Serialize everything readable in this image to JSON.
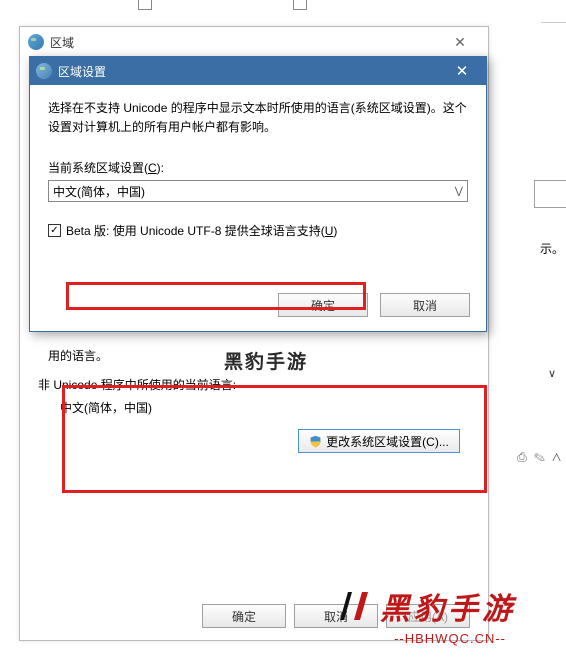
{
  "bg": {
    "right_text": "示。",
    "right_v": "∨",
    "right_icons": "⎙ ✎ ⋀"
  },
  "outer": {
    "title": "区域",
    "body_trail": "用的语言。",
    "section_label": "非 Unicode 程序中所使用的当前语言:",
    "lang_value": "中文(简体，中国)",
    "change_btn": "更改系统区域设置(C)...",
    "btn_ok": "确定",
    "btn_cancel": "取消",
    "btn_apply": "应用(A)"
  },
  "inner": {
    "title": "区域设置",
    "desc": "选择在不支持 Unicode 的程序中显示文本时所使用的语言(系统区域设置)。这个设置对计算机上的所有用户帐户都有影响。",
    "label_pre": "当前系统区域设置(",
    "label_u": "C",
    "label_post": "):",
    "select_value": "中文(简体，中国)",
    "checkbox_pre": "Beta 版: 使用 Unicode UTF-8 提供全球语言支持(",
    "checkbox_u": "U",
    "checkbox_post": ")",
    "btn_ok": "确定",
    "btn_cancel": "取消"
  },
  "watermark": {
    "text1": "黑豹手游",
    "text2": "黑豹手游",
    "url": "--HBHWQC.CN--"
  }
}
